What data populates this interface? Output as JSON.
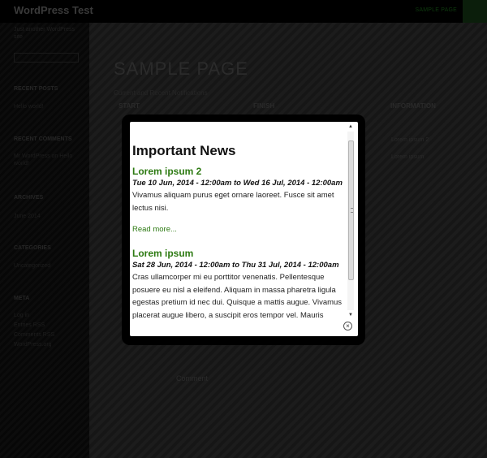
{
  "site": {
    "title": "WordPress Test",
    "tagline": "Just another WordPress site",
    "nav_item": "SAMPLE PAGE"
  },
  "sidebar": {
    "sections": [
      {
        "heading": "RECENT POSTS",
        "links": [
          "Hello world!"
        ]
      },
      {
        "heading": "RECENT COMMENTS",
        "links": [
          "Mr WordPress on Hello world!"
        ]
      },
      {
        "heading": "ARCHIVES",
        "links": [
          "June 2014"
        ]
      },
      {
        "heading": "CATEGORIES",
        "links": [
          "Uncategorized"
        ]
      },
      {
        "heading": "META",
        "links": [
          "Log in",
          "Entries RSS",
          "Comments RSS",
          "WordPress.org"
        ]
      }
    ]
  },
  "main": {
    "page_title": "SAMPLE PAGE",
    "intro": "Current and Recent Notifications",
    "columns": [
      "START",
      "FINISH",
      "INFORMATION"
    ],
    "info_cells": [
      "Lorem ipsum 2",
      "Lorem ipsum"
    ],
    "comment_label": "Comment"
  },
  "modal": {
    "title": "Important News",
    "read_more": "Read more...",
    "items": [
      {
        "title": "Lorem ipsum 2",
        "date": "Tue 10 Jun, 2014 - 12:00am to Wed 16 Jul, 2014 - 12:00am",
        "body": "Vivamus aliquam purus eget ornare laoreet. Fusce sit amet lectus nisi."
      },
      {
        "title": "Lorem ipsum",
        "date": "Sat 28 Jun, 2014 - 12:00am to Thu 31 Jul, 2014 - 12:00am",
        "body": "Cras ullamcorper mi eu porttitor venenatis. Pellentesque posuere eu nisl a eleifend. Aliquam in massa pharetra ligula egestas pretium id nec dui. Quisque a mattis augue. Vivamus placerat augue libero, a suscipit eros tempor vel. Mauris aliquet"
      }
    ],
    "scroll_up_icon": "▲",
    "scroll_down_icon": "▼",
    "close_icon": "×"
  }
}
